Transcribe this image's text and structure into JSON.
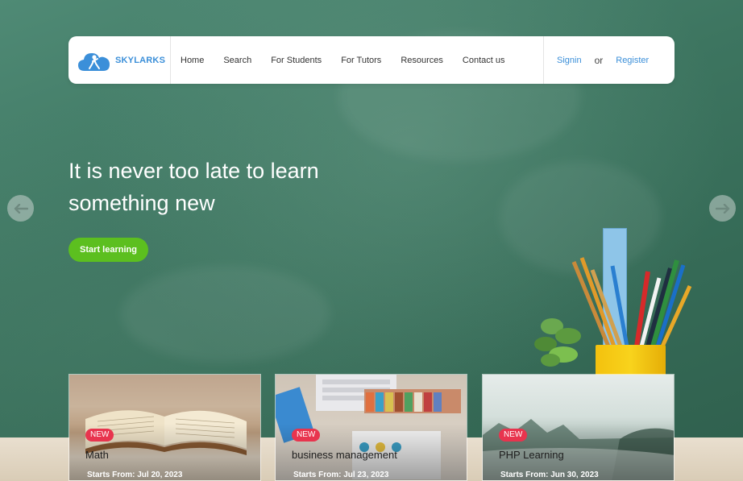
{
  "brand": {
    "name": "SKYLARKS",
    "logo_icon": "cloud-person-icon",
    "color": "#3b8fd9"
  },
  "nav": {
    "items": [
      {
        "label": "Home"
      },
      {
        "label": "Search"
      },
      {
        "label": "For Students"
      },
      {
        "label": "For Tutors"
      },
      {
        "label": "Resources"
      },
      {
        "label": "Contact us"
      }
    ],
    "signin": "Signin",
    "or": "or",
    "register": "Register"
  },
  "hero": {
    "headline_line1": "It is never too late to learn",
    "headline_line2": "something new",
    "cta_label": "Start learning",
    "cta_color": "#5cbf1f",
    "prev_icon": "arrow-left-icon",
    "next_icon": "arrow-right-icon"
  },
  "courses": [
    {
      "badge": "NEW",
      "title": "Math",
      "date": "Starts From: Jul 20, 2023"
    },
    {
      "badge": "NEW",
      "title": "business management",
      "date": "Starts From: Jul 23, 2023"
    },
    {
      "badge": "NEW",
      "title": "PHP Learning",
      "date": "Starts From: Jun 30, 2023"
    }
  ],
  "colors": {
    "badge": "#e8344e",
    "link": "#3b8fd9"
  }
}
